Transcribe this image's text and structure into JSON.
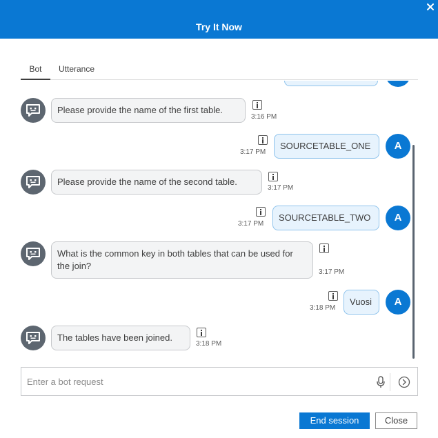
{
  "header": {
    "title": "Try It Now"
  },
  "tabs": [
    {
      "label": "Bot"
    },
    {
      "label": "Utterance"
    }
  ],
  "messages": [
    {
      "from": "bot",
      "text": "Please provide the name of the first table.",
      "time": "3:16 PM"
    },
    {
      "from": "user",
      "avatar": "A",
      "text": "SOURCETABLE_ONE",
      "time": "3:17 PM"
    },
    {
      "from": "bot",
      "text": "Please provide the name of the second table.",
      "time": "3:17 PM"
    },
    {
      "from": "user",
      "avatar": "A",
      "text": "SOURCETABLE_TWO",
      "time": "3:17 PM"
    },
    {
      "from": "bot",
      "text": "What is the common key in both tables that can be used for the join?",
      "time": "3:17 PM"
    },
    {
      "from": "user",
      "avatar": "A",
      "text": "Vuosi",
      "time": "3:18 PM"
    },
    {
      "from": "bot",
      "text": "The tables have been joined.",
      "time": "3:18 PM"
    }
  ],
  "input": {
    "placeholder": "Enter a bot request",
    "value": ""
  },
  "buttons": {
    "end_session": "End session",
    "close": "Close"
  },
  "icons": {
    "close": "close-icon",
    "bot_avatar": "bot-chat-icon",
    "info": "info-icon",
    "mic": "microphone-icon",
    "send": "send-arrow-icon"
  },
  "colors": {
    "header": "#0a78d3",
    "user_avatar": "#0a78d3",
    "bot_avatar": "#5d6670",
    "user_bubble": "#e7f3fd",
    "bot_bubble": "#f3f4f5"
  }
}
